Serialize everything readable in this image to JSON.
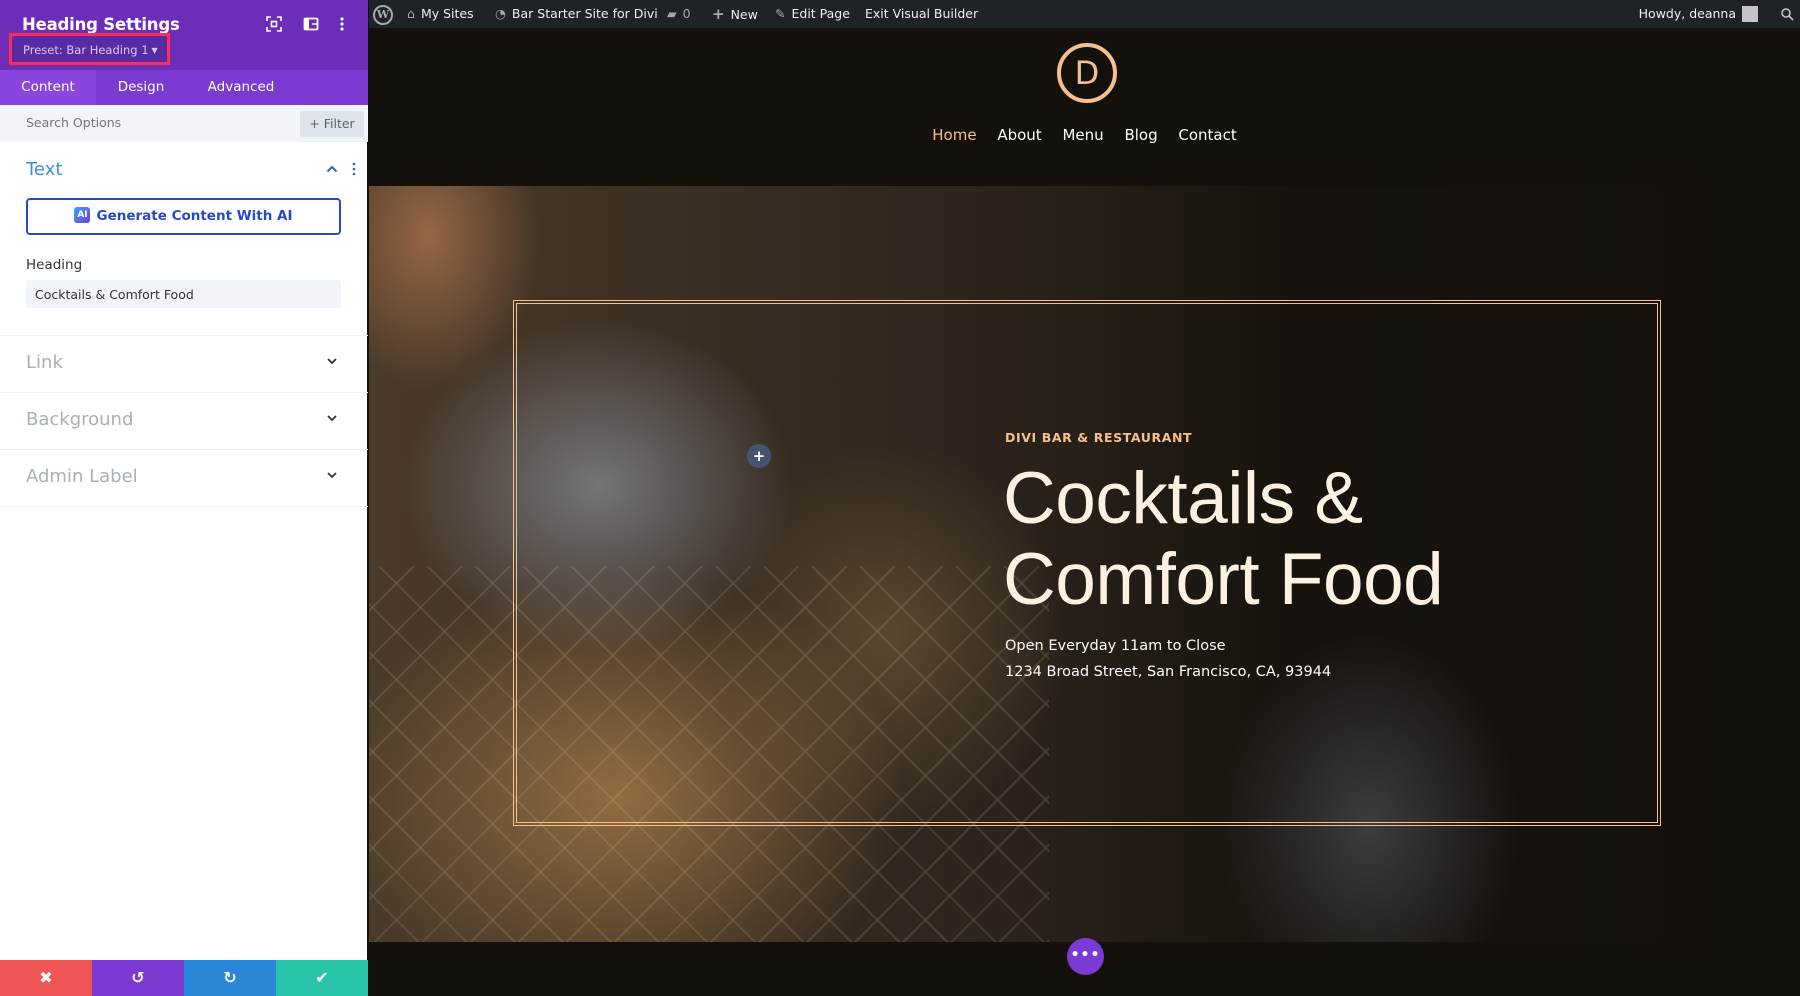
{
  "panel": {
    "title": "Heading Settings",
    "preset_label": "Preset: Bar Heading 1",
    "header_icons": [
      "focus-icon",
      "split-view-icon",
      "more-options-icon"
    ],
    "tabs": [
      {
        "label": "Content",
        "active": true
      },
      {
        "label": "Design",
        "active": false
      },
      {
        "label": "Advanced",
        "active": false
      }
    ],
    "search": {
      "placeholder": "Search Options",
      "value": ""
    },
    "filter_label": "+ Filter",
    "sections": {
      "text": {
        "title": "Text",
        "expanded": true,
        "ai_button_label": "Generate Content With AI",
        "ai_icon_text": "AI",
        "heading_label": "Heading",
        "heading_value": "Cocktails & Comfort Food"
      },
      "link": {
        "title": "Link",
        "expanded": false
      },
      "background": {
        "title": "Background",
        "expanded": false
      },
      "admin_label": {
        "title": "Admin Label",
        "expanded": false
      }
    },
    "footer": {
      "cancel_icon": "✖",
      "undo_icon": "↺",
      "redo_icon": "↻",
      "save_icon": "✔",
      "colors": {
        "cancel": "#ef5554",
        "undo": "#7b3bd2",
        "redo": "#2b87da",
        "save": "#29c4a9"
      }
    },
    "accent_color": "#6c2eb9"
  },
  "adminbar": {
    "my_sites": "My Sites",
    "site_name": "Bar Starter Site for Divi",
    "comments_count": "0",
    "new_label": "New",
    "edit_page": "Edit Page",
    "exit_builder": "Exit Visual Builder",
    "howdy": "Howdy, deanna"
  },
  "site": {
    "logo_letter": "D",
    "nav": [
      {
        "label": "Home",
        "active": true
      },
      {
        "label": "About",
        "active": false
      },
      {
        "label": "Menu",
        "active": false
      },
      {
        "label": "Blog",
        "active": false
      },
      {
        "label": "Contact",
        "active": false
      }
    ],
    "hero": {
      "eyebrow": "DIVI BAR & RESTAURANT",
      "title_line1": "Cocktails &",
      "title_line2": "Comfort Food",
      "hours": "Open Everyday 11am to Close",
      "address": "1234 Broad Street, San Francisco, CA, 93944",
      "add_symbol": "+"
    },
    "accent_color": "#f4c08f",
    "fab_symbol": "•••"
  }
}
